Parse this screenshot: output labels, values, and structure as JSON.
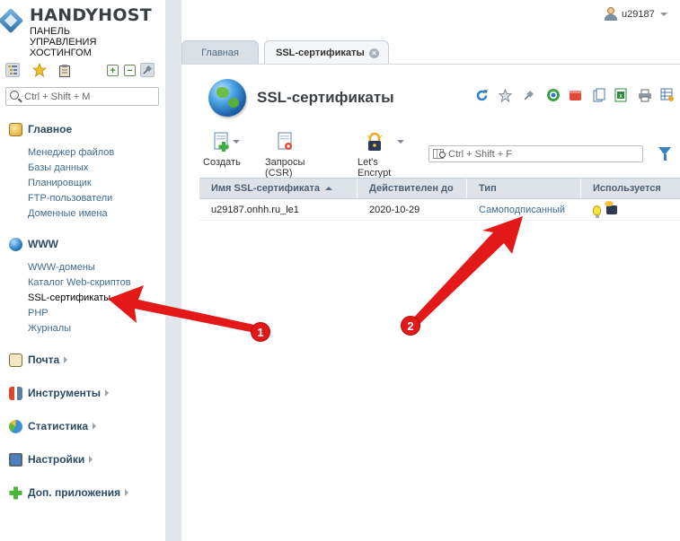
{
  "brand": {
    "name": "HANDYHOST",
    "subtitle_lines": [
      "ПАНЕЛЬ",
      "УПРАВЛЕНИЯ",
      "ХОСТИНГОМ"
    ]
  },
  "sidebar": {
    "search_placeholder": "Ctrl + Shift + M",
    "sections": [
      {
        "title": "Главное",
        "icon": "home-icon",
        "expanded": true,
        "items": [
          "Менеджер файлов",
          "Базы данных",
          "Планировщик",
          "FTP-пользователи",
          "Доменные имена"
        ]
      },
      {
        "title": "WWW",
        "icon": "globe-icon",
        "expanded": true,
        "items": [
          "WWW-домены",
          "Каталог Web-скриптов",
          "SSL-сертификаты",
          "PHP",
          "Журналы"
        ]
      },
      {
        "title": "Почта",
        "icon": "mail-icon",
        "expanded": false
      },
      {
        "title": "Инструменты",
        "icon": "tools-icon",
        "expanded": false
      },
      {
        "title": "Статистика",
        "icon": "pie-chart-icon",
        "expanded": false
      },
      {
        "title": "Настройки",
        "icon": "settings-monitor-icon",
        "expanded": false
      },
      {
        "title": "Доп. приложения",
        "icon": "plus-icon",
        "expanded": false
      }
    ],
    "current_item": "SSL-сертификаты"
  },
  "user": {
    "name": "u29187"
  },
  "tabs": [
    {
      "label": "Главная",
      "active": false
    },
    {
      "label": "SSL-сертификаты",
      "active": true
    }
  ],
  "page": {
    "title": "SSL-сертификаты",
    "toolbar": [
      {
        "label": "Создать",
        "icon": "add-document-icon"
      },
      {
        "label": "Запросы (CSR)",
        "icon": "csr-document-icon"
      },
      {
        "label": "Let's Encrypt",
        "icon": "lock-icon"
      }
    ],
    "search_placeholder": "Ctrl + Shift + F"
  },
  "table": {
    "columns": [
      "Имя SSL-сертификата",
      "Действителен до",
      "Тип",
      "Используется"
    ],
    "rows": [
      {
        "name": "u29187.onhh.ru_le1",
        "valid_until": "2020-10-29",
        "type": "Самоподписанный"
      }
    ]
  },
  "annotations": {
    "badge1": "1",
    "badge2": "2",
    "color": "#e31818"
  }
}
